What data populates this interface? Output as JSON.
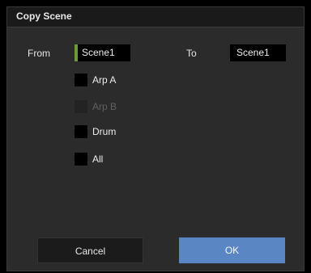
{
  "dialog": {
    "title": "Copy Scene",
    "from_label": "From",
    "from_value": "Scene1",
    "to_label": "To",
    "to_value": "Scene1",
    "options": [
      {
        "label": "Arp A",
        "checked": false,
        "enabled": true
      },
      {
        "label": "Arp B",
        "checked": false,
        "enabled": false
      },
      {
        "label": "Drum",
        "checked": false,
        "enabled": true
      },
      {
        "label": "All",
        "checked": false,
        "enabled": true
      }
    ],
    "cancel_label": "Cancel",
    "ok_label": "OK"
  },
  "colors": {
    "accent_green": "#6a9a3a",
    "ok_blue": "#5b86c4",
    "panel_bg": "#2b2b2b"
  }
}
